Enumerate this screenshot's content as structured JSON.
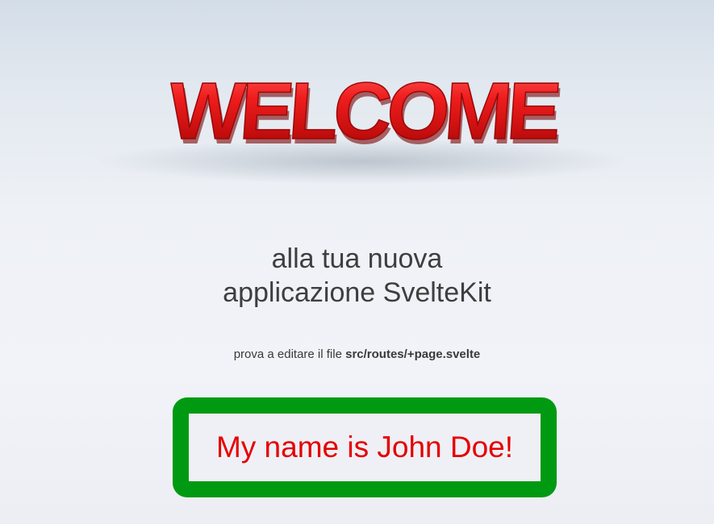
{
  "hero": {
    "banner_text": "WELCOME"
  },
  "subtitle": {
    "line1": "alla tua nuova",
    "line2": "applicazione SvelteKit"
  },
  "hint": {
    "prefix": "prova a editare il file ",
    "file": "src/routes/+page.svelte"
  },
  "name_card": {
    "text": "My name is John Doe!"
  },
  "colors": {
    "welcome_red": "#e01818",
    "card_border": "#009a12",
    "card_text": "#e50000"
  }
}
